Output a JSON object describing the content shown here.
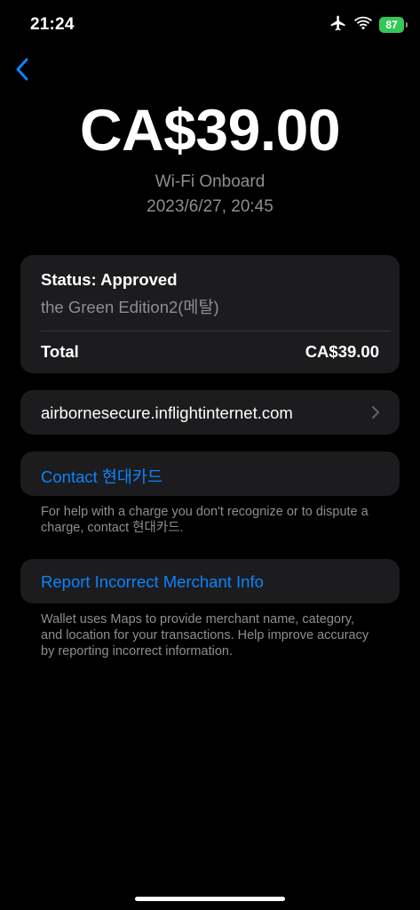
{
  "status_bar": {
    "time": "21:24",
    "battery_level": "87",
    "icons": [
      "airplane-icon",
      "wifi-icon",
      "battery-icon"
    ],
    "battery_color": "#34c759"
  },
  "nav": {
    "back_icon": "chevron-left-icon",
    "accent_color": "#0a84ff"
  },
  "transaction": {
    "amount": "CA$39.00",
    "merchant": "Wi-Fi Onboard",
    "datetime": "2023/6/27, 20:45"
  },
  "status_card": {
    "status": "Status: Approved",
    "card_name": "the Green Edition2(메탈)",
    "total_label": "Total",
    "total_value": "CA$39.00"
  },
  "merchant_link": {
    "url": "airbornesecure.inflightinternet.com",
    "icon": "chevron-right-icon"
  },
  "contact": {
    "label": "Contact 현대카드",
    "note": "For help with a charge you don't recognize or to dispute a charge, contact 현대카드."
  },
  "report": {
    "label": "Report Incorrect Merchant Info",
    "note": "Wallet uses Maps to provide merchant name, category, and location for your transactions. Help improve accuracy by reporting incorrect information."
  }
}
